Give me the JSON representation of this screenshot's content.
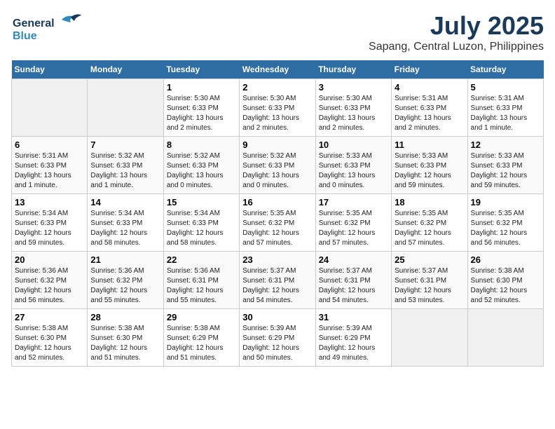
{
  "header": {
    "logo_general": "General",
    "logo_blue": "Blue",
    "month_year": "July 2025",
    "location": "Sapang, Central Luzon, Philippines"
  },
  "weekdays": [
    "Sunday",
    "Monday",
    "Tuesday",
    "Wednesday",
    "Thursday",
    "Friday",
    "Saturday"
  ],
  "weeks": [
    [
      {
        "day": "",
        "info": ""
      },
      {
        "day": "",
        "info": ""
      },
      {
        "day": "1",
        "sunrise": "5:30 AM",
        "sunset": "6:33 PM",
        "daylight": "13 hours and 2 minutes."
      },
      {
        "day": "2",
        "sunrise": "5:30 AM",
        "sunset": "6:33 PM",
        "daylight": "13 hours and 2 minutes."
      },
      {
        "day": "3",
        "sunrise": "5:30 AM",
        "sunset": "6:33 PM",
        "daylight": "13 hours and 2 minutes."
      },
      {
        "day": "4",
        "sunrise": "5:31 AM",
        "sunset": "6:33 PM",
        "daylight": "13 hours and 2 minutes."
      },
      {
        "day": "5",
        "sunrise": "5:31 AM",
        "sunset": "6:33 PM",
        "daylight": "13 hours and 1 minute."
      }
    ],
    [
      {
        "day": "6",
        "sunrise": "5:31 AM",
        "sunset": "6:33 PM",
        "daylight": "13 hours and 1 minute."
      },
      {
        "day": "7",
        "sunrise": "5:32 AM",
        "sunset": "6:33 PM",
        "daylight": "13 hours and 1 minute."
      },
      {
        "day": "8",
        "sunrise": "5:32 AM",
        "sunset": "6:33 PM",
        "daylight": "13 hours and 0 minutes."
      },
      {
        "day": "9",
        "sunrise": "5:32 AM",
        "sunset": "6:33 PM",
        "daylight": "13 hours and 0 minutes."
      },
      {
        "day": "10",
        "sunrise": "5:33 AM",
        "sunset": "6:33 PM",
        "daylight": "13 hours and 0 minutes."
      },
      {
        "day": "11",
        "sunrise": "5:33 AM",
        "sunset": "6:33 PM",
        "daylight": "12 hours and 59 minutes."
      },
      {
        "day": "12",
        "sunrise": "5:33 AM",
        "sunset": "6:33 PM",
        "daylight": "12 hours and 59 minutes."
      }
    ],
    [
      {
        "day": "13",
        "sunrise": "5:34 AM",
        "sunset": "6:33 PM",
        "daylight": "12 hours and 59 minutes."
      },
      {
        "day": "14",
        "sunrise": "5:34 AM",
        "sunset": "6:33 PM",
        "daylight": "12 hours and 58 minutes."
      },
      {
        "day": "15",
        "sunrise": "5:34 AM",
        "sunset": "6:33 PM",
        "daylight": "12 hours and 58 minutes."
      },
      {
        "day": "16",
        "sunrise": "5:35 AM",
        "sunset": "6:32 PM",
        "daylight": "12 hours and 57 minutes."
      },
      {
        "day": "17",
        "sunrise": "5:35 AM",
        "sunset": "6:32 PM",
        "daylight": "12 hours and 57 minutes."
      },
      {
        "day": "18",
        "sunrise": "5:35 AM",
        "sunset": "6:32 PM",
        "daylight": "12 hours and 57 minutes."
      },
      {
        "day": "19",
        "sunrise": "5:35 AM",
        "sunset": "6:32 PM",
        "daylight": "12 hours and 56 minutes."
      }
    ],
    [
      {
        "day": "20",
        "sunrise": "5:36 AM",
        "sunset": "6:32 PM",
        "daylight": "12 hours and 56 minutes."
      },
      {
        "day": "21",
        "sunrise": "5:36 AM",
        "sunset": "6:32 PM",
        "daylight": "12 hours and 55 minutes."
      },
      {
        "day": "22",
        "sunrise": "5:36 AM",
        "sunset": "6:31 PM",
        "daylight": "12 hours and 55 minutes."
      },
      {
        "day": "23",
        "sunrise": "5:37 AM",
        "sunset": "6:31 PM",
        "daylight": "12 hours and 54 minutes."
      },
      {
        "day": "24",
        "sunrise": "5:37 AM",
        "sunset": "6:31 PM",
        "daylight": "12 hours and 54 minutes."
      },
      {
        "day": "25",
        "sunrise": "5:37 AM",
        "sunset": "6:31 PM",
        "daylight": "12 hours and 53 minutes."
      },
      {
        "day": "26",
        "sunrise": "5:38 AM",
        "sunset": "6:30 PM",
        "daylight": "12 hours and 52 minutes."
      }
    ],
    [
      {
        "day": "27",
        "sunrise": "5:38 AM",
        "sunset": "6:30 PM",
        "daylight": "12 hours and 52 minutes."
      },
      {
        "day": "28",
        "sunrise": "5:38 AM",
        "sunset": "6:30 PM",
        "daylight": "12 hours and 51 minutes."
      },
      {
        "day": "29",
        "sunrise": "5:38 AM",
        "sunset": "6:29 PM",
        "daylight": "12 hours and 51 minutes."
      },
      {
        "day": "30",
        "sunrise": "5:39 AM",
        "sunset": "6:29 PM",
        "daylight": "12 hours and 50 minutes."
      },
      {
        "day": "31",
        "sunrise": "5:39 AM",
        "sunset": "6:29 PM",
        "daylight": "12 hours and 49 minutes."
      },
      {
        "day": "",
        "info": ""
      },
      {
        "day": "",
        "info": ""
      }
    ]
  ]
}
